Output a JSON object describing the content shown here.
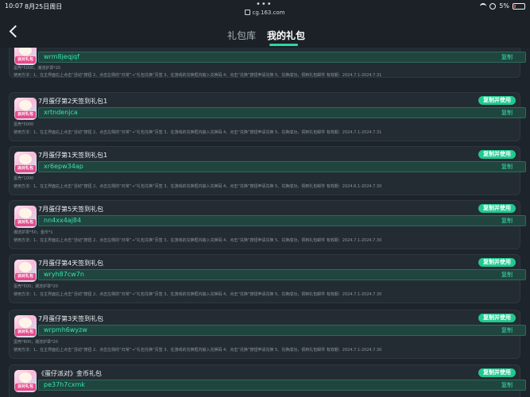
{
  "status_bar": {
    "time": "10:07",
    "date": "8月25日周日",
    "url": "cg.163.com",
    "battery": "5%"
  },
  "nav": {
    "tabs": [
      {
        "label": "礼包库",
        "active": false
      },
      {
        "label": "我的礼包",
        "active": true
      }
    ],
    "accent": "#31d6a0"
  },
  "gifts": [
    {
      "title": "",
      "code": "wrm8jeqjqf",
      "copy_label": "复制",
      "copy_use_label": "",
      "reward": "蛋壳*5000；潮流护罩*20",
      "usage": "使用方法：1、在主界面右上点击“活动”按钮 2、点击左侧的“日常”→“礼包兑换”页签 3、在游戏的兑换框内输入兑换码 4、点击“兑换”按钮申请兑换 5、兑换成功，领到礼包邮件 有效期：2024.7.1-2024.7.31"
    },
    {
      "title": "7月蛋仔第2天签到礼包1",
      "code": "xrtndenjca",
      "copy_label": "复制",
      "copy_use_label": "复制并使用",
      "reward": "蛋壳*5000",
      "usage": "使用方法：1、在主界面右上点击“活动”按钮 2、点击左侧的“日常”→“礼包兑换”页签 3、在游戏的兑换框内输入兑换码 4、点击“兑换”按钮申请兑换 5、兑换成功，领到礼包邮件 有效期：2024.7.1-2024.7.31"
    },
    {
      "title": "7月蛋仔第1天签到礼包1",
      "code": "xr6epw34ap",
      "copy_label": "复制",
      "copy_use_label": "复制并使用",
      "reward": "蛋壳*1000",
      "usage": "使用方法：1、在主界面右上点击“活动”按钮 2、点击左侧的“日常”→“礼包兑换”页签 3、在游戏的兑换框内输入兑换码 4、点击“兑换”按钮申请兑换 5、兑换成功，领到礼包邮件 有效期：2024.6.1-2024.7.30"
    },
    {
      "title": "7月蛋仔第5天签到礼包",
      "code": "nn4xx4aj84",
      "copy_label": "复制",
      "copy_use_label": "复制并使用",
      "reward": "潮流护罩*50；金币*1",
      "usage": "使用方法：1、在主界面右上点击“活动”按钮 2、点击左侧的“日常”→“礼包兑换”页签 3、在游戏的兑换框内输入兑换码 4、点击“兑换”按钮申请兑换 5、兑换成功，领到礼包邮件 有效期：2024.7.1-2024.7.30"
    },
    {
      "title": "7月蛋仔第4天签到礼包",
      "code": "wryh87cw7n",
      "copy_label": "复制",
      "copy_use_label": "复制并使用",
      "reward": "蛋壳*500；潮流护罩*20",
      "usage": "使用方法：1、在主界面右上点击“活动”按钮 2、点击左侧的“日常”→“礼包兑换”页签 3、在游戏的兑换框内输入兑换码 4、点击“兑换”按钮申请兑换 5、兑换成功，领到礼包邮件 有效期：2024.7.1-2024.7.30"
    },
    {
      "title": "7月蛋仔第3天签到礼包",
      "code": "wrpmh6wyzw",
      "copy_label": "复制",
      "copy_use_label": "复制并使用",
      "reward": "蛋壳*800；潮流护罩*20",
      "usage": "使用方法：1、在主界面右上点击“活动”按钮 2、点击左侧的“日常”→“礼包兑换”页签 3、在游戏的兑换框内输入兑换码 4、点击“兑换”按钮申请兑换 5、兑换成功，领到礼包邮件 有效期：2024.7.1-2024.7.30"
    },
    {
      "title": "《蛋仔派对》金币礼包",
      "code": "pe37h7cxmk",
      "copy_label": "复制",
      "copy_use_label": "复制并使用",
      "reward": "",
      "usage": ""
    }
  ],
  "icon_tag": "派对礼包"
}
